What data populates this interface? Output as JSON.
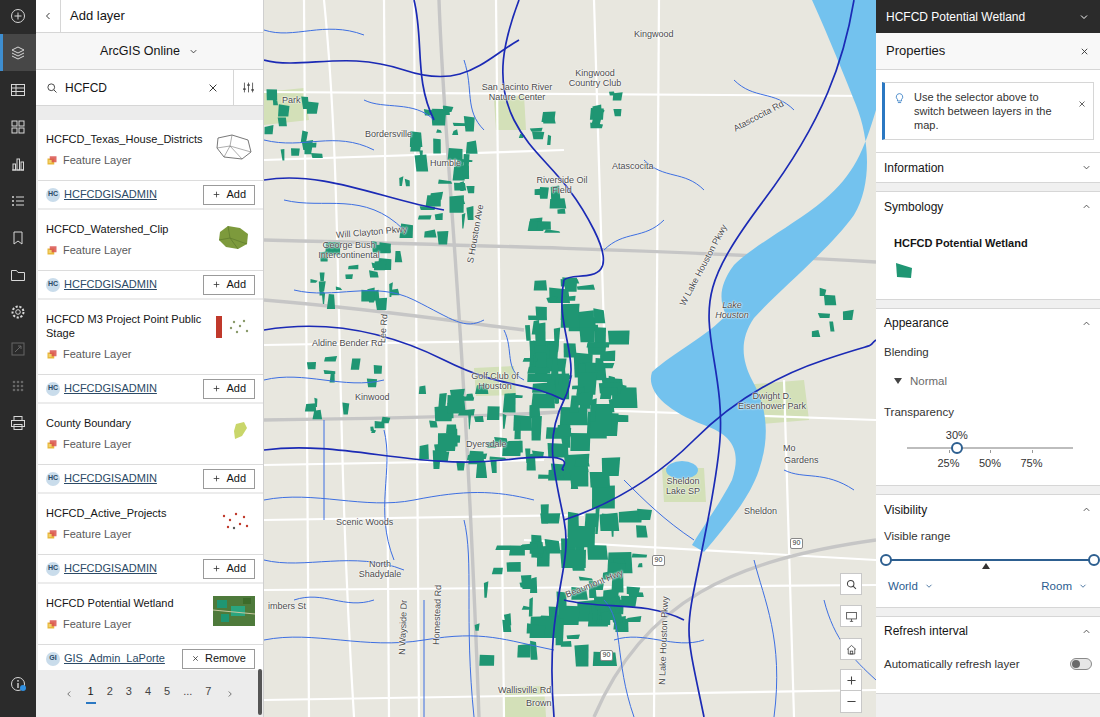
{
  "toolbar": {
    "items": [
      {
        "selected": false,
        "disabled": false
      },
      {
        "selected": true,
        "disabled": false
      },
      {
        "selected": false,
        "disabled": false
      },
      {
        "selected": false,
        "disabled": false
      },
      {
        "selected": false,
        "disabled": false
      },
      {
        "selected": false,
        "disabled": false
      },
      {
        "selected": false,
        "disabled": false
      },
      {
        "selected": false,
        "disabled": false
      },
      {
        "selected": false,
        "disabled": false
      },
      {
        "selected": false,
        "disabled": true
      },
      {
        "selected": false,
        "disabled": true
      },
      {
        "selected": false,
        "disabled": false
      }
    ],
    "info": {
      "notification": true
    }
  },
  "add_layer": {
    "title": "Add layer",
    "source": "ArcGIS Online",
    "search": {
      "value": "HCFCD"
    },
    "results": [
      {
        "title": "HCFCD_Texas_House_Districts",
        "type": "Feature Layer",
        "owner_initials": "HC",
        "owner": "HCFCDGISADMIN",
        "action": "Add",
        "added": false
      },
      {
        "title": "HCFCD_Watershed_Clip",
        "type": "Feature Layer",
        "owner_initials": "HC",
        "owner": "HCFCDGISADMIN",
        "action": "Add",
        "added": false
      },
      {
        "title": "HCFCD M3 Project Point Public Stage",
        "type": "Feature Layer",
        "owner_initials": "HC",
        "owner": "HCFCDGISADMIN",
        "action": "Add",
        "added": false
      },
      {
        "title": "County Boundary",
        "type": "Feature Layer",
        "owner_initials": "HC",
        "owner": "HCFCDGISADMIN",
        "action": "Add",
        "added": false
      },
      {
        "title": "HCFCD_Active_Projects",
        "type": "Feature Layer",
        "owner_initials": "HC",
        "owner": "HCFCDGISADMIN",
        "action": "Add",
        "added": false
      },
      {
        "title": "HCFCD Potential Wetland",
        "type": "Feature Layer",
        "owner_initials": "GI",
        "owner": "GIS_Admin_LaPorte",
        "action": "Remove",
        "added": true
      }
    ],
    "pagination": {
      "pages": [
        {
          "label": "1",
          "selected": true
        },
        {
          "label": "2",
          "selected": false
        },
        {
          "label": "3",
          "selected": false
        },
        {
          "label": "4",
          "selected": false
        },
        {
          "label": "5",
          "selected": false
        },
        {
          "label": "...",
          "selected": false
        },
        {
          "label": "7",
          "selected": false
        }
      ]
    }
  },
  "map": {
    "labels": [
      "Kingwood",
      "Kingwood Country Club",
      "San Jacinto River Nature Center",
      "Park",
      "Bordersville",
      "Humble",
      "Atascocita",
      "Atascocita Rd",
      "Riverside Oil Field",
      "Will Clayton Pkwy",
      "George Bush Intercontinental",
      "S Houston Ave",
      "W Lake Houston Pkwy",
      "Lake Houston",
      "Aldine Bender Rd",
      "Lee Rd",
      "Golf Club of Houston",
      "Kinwood",
      "Dyersdale",
      "Dwight D. Eisenhower Park",
      "Mo",
      "Gardens",
      "Sheldon Lake SP",
      "Sheldon",
      "Scenic Woods",
      "North Shadydale",
      "Beaumont Hwy",
      "Wallisville Rd",
      "Brown",
      "imbers St",
      "Homestead Rd",
      "N Wayside Dr",
      "N Lake Houston Pkwy"
    ],
    "shields": [
      "90",
      "90",
      "90"
    ]
  },
  "properties": {
    "layer": "HCFCD Potential Wetland",
    "title": "Properties",
    "tip": "Use the selector above to switch between layers in the map.",
    "information": {
      "title": "Information",
      "expanded": false
    },
    "symbology": {
      "title": "Symbology",
      "expanded": true,
      "layer": "HCFCD Potential Wetland"
    },
    "appearance": {
      "title": "Appearance",
      "expanded": true,
      "blending_label": "Blending",
      "blending": "Normal",
      "transparency_label": "Transparency",
      "transparency_reading": "30%",
      "transparency_level": 0.3,
      "ticks": [
        "25%",
        "50%",
        "75%"
      ]
    },
    "visibility": {
      "title": "Visibility",
      "expanded": true,
      "label": "Visible range",
      "min_level": 0,
      "max_level": 1,
      "current_level": 0.48,
      "min": "World",
      "max": "Room"
    },
    "refresh": {
      "title": "Refresh interval",
      "expanded": true,
      "label": "Automatically refresh layer",
      "on": false
    }
  }
}
